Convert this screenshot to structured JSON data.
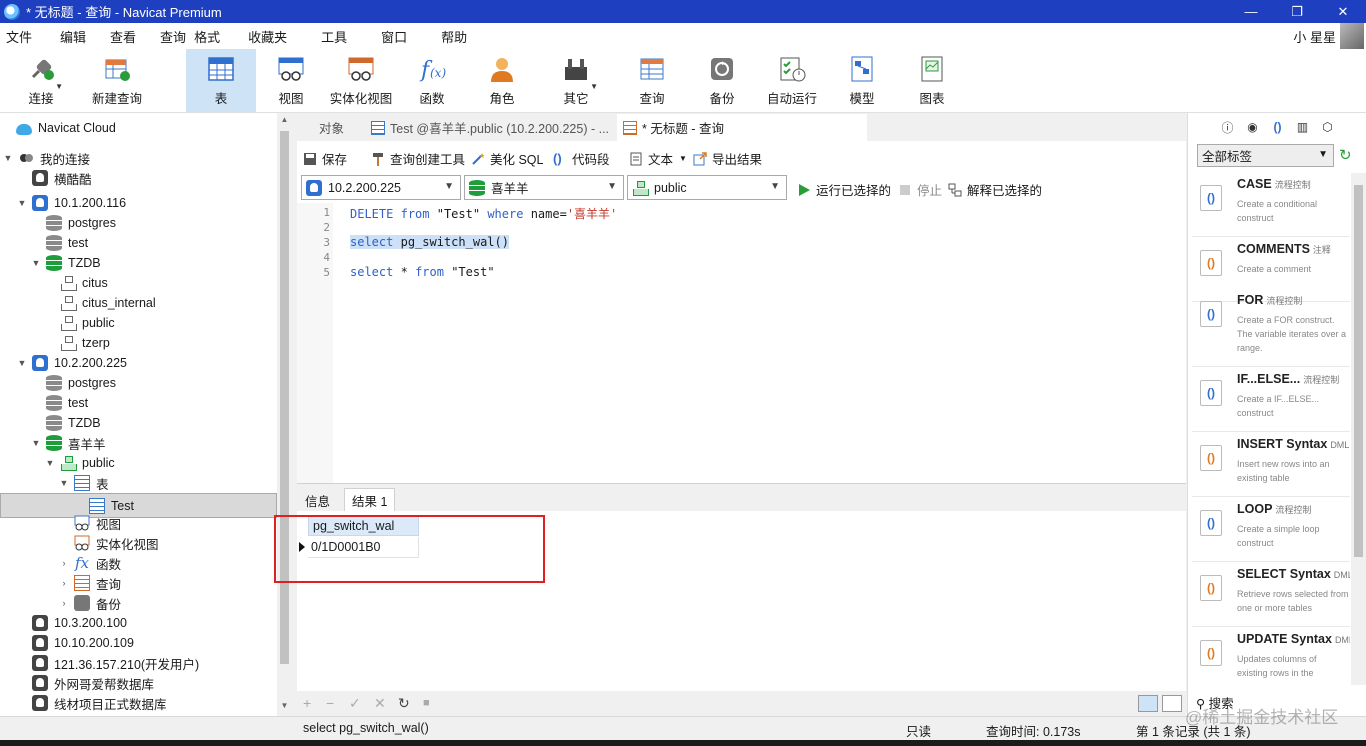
{
  "window": {
    "title": "* 无标题 - 查询 - Navicat Premium",
    "minimize": "—",
    "restore": "❐",
    "close": "✕"
  },
  "menu": {
    "items": [
      "文件",
      "编辑",
      "查看",
      "查询",
      "格式",
      "收藏夹",
      "工具",
      "窗口",
      "帮助"
    ],
    "user": "小 星星"
  },
  "toolbar": {
    "items": [
      {
        "label": "连接",
        "icon": "plug-icon"
      },
      {
        "label": "新建查询",
        "icon": "new-query-icon"
      },
      {
        "label": "表",
        "icon": "table-icon"
      },
      {
        "label": "视图",
        "icon": "view-icon"
      },
      {
        "label": "实体化视图",
        "icon": "materialized-view-icon"
      },
      {
        "label": "函数",
        "icon": "function-icon"
      },
      {
        "label": "角色",
        "icon": "role-icon"
      },
      {
        "label": "其它",
        "icon": "tools-icon"
      },
      {
        "label": "查询",
        "icon": "query-icon"
      },
      {
        "label": "备份",
        "icon": "backup-icon"
      },
      {
        "label": "自动运行",
        "icon": "automation-icon"
      },
      {
        "label": "模型",
        "icon": "model-icon"
      },
      {
        "label": "图表",
        "icon": "chart-icon"
      }
    ]
  },
  "tree": {
    "nodes": [
      {
        "label": "Navicat Cloud"
      },
      {
        "label": "我的连接"
      },
      {
        "label": "横酷酷"
      },
      {
        "label": "10.1.200.116"
      },
      {
        "label": "postgres"
      },
      {
        "label": "test"
      },
      {
        "label": "TZDB"
      },
      {
        "label": "citus"
      },
      {
        "label": "citus_internal"
      },
      {
        "label": "public"
      },
      {
        "label": "tzerp"
      },
      {
        "label": "10.2.200.225"
      },
      {
        "label": "postgres"
      },
      {
        "label": "test"
      },
      {
        "label": "TZDB"
      },
      {
        "label": "喜羊羊"
      },
      {
        "label": "public"
      },
      {
        "label": "表"
      },
      {
        "label": "Test"
      },
      {
        "label": "视图"
      },
      {
        "label": "实体化视图"
      },
      {
        "label": "函数"
      },
      {
        "label": "查询"
      },
      {
        "label": "备份"
      },
      {
        "label": "10.3.200.100"
      },
      {
        "label": "10.10.200.109"
      },
      {
        "label": "121.36.157.210(开发用户)"
      },
      {
        "label": "外网哥爱帮数据库"
      },
      {
        "label": "线材项目正式数据库"
      }
    ]
  },
  "tabs": {
    "objects": "对象",
    "table_tab": "Test @喜羊羊.public (10.2.200.225) - ...",
    "query_tab": "* 无标题 - 查询"
  },
  "query_toolbar": {
    "save": "保存",
    "builder": "查询创建工具",
    "beautify": "美化 SQL",
    "snippet": "代码段",
    "text": "文本",
    "export": "导出结果"
  },
  "selectors": {
    "connection": "10.2.200.225",
    "database": "喜羊羊",
    "schema": "public",
    "run_selected": "运行已选择的",
    "stop": "停止",
    "explain_selected": "解释已选择的"
  },
  "editor": {
    "line_numbers": [
      "1",
      "2",
      "3",
      "4",
      "5"
    ],
    "line1": {
      "kw1": "DELETE",
      "kw2": "from",
      "t1": "\"Test\"",
      "kw3": "where",
      "t2": "name=",
      "s": "'喜羊羊'"
    },
    "line3": {
      "kw": "select",
      "t": "pg_switch_wal()"
    },
    "line5": {
      "kw1": "select",
      "t1": "*",
      "kw2": "from",
      "t2": "\"Test\""
    }
  },
  "result_tabs": {
    "info": "信息",
    "result1": "结果 1"
  },
  "result": {
    "columns": [
      "pg_switch_wal"
    ],
    "rows": [
      [
        "0/1D0001B0"
      ]
    ]
  },
  "grid_toolbar": {
    "add": "+",
    "remove": "−",
    "apply": "✓",
    "discard": "✕",
    "refresh": "↻",
    "stop": "■"
  },
  "snippets_panel": {
    "filter": "全部标签",
    "items": [
      {
        "name": "CASE",
        "tag": "流程控制",
        "desc": "Create a conditional construct"
      },
      {
        "name": "COMMENTS",
        "tag": "注释",
        "desc": "Create a comment"
      },
      {
        "name": "FOR",
        "tag": "流程控制",
        "desc": "Create a FOR construct. The variable iterates over a range."
      },
      {
        "name": "IF...ELSE...",
        "tag": "流程控制",
        "desc": "Create a IF...ELSE... construct"
      },
      {
        "name": "INSERT Syntax",
        "tag": "DML",
        "desc": "Insert new rows into an existing table"
      },
      {
        "name": "LOOP",
        "tag": "流程控制",
        "desc": "Create a simple loop construct"
      },
      {
        "name": "SELECT Syntax",
        "tag": "DML",
        "desc": "Retrieve rows selected from one or more tables"
      },
      {
        "name": "UPDATE Syntax",
        "tag": "DML",
        "desc": "Updates columns of existing rows in the"
      }
    ],
    "search": "搜索"
  },
  "status": {
    "sql": "select pg_switch_wal()",
    "readonly": "只读",
    "time": "查询时间: 0.173s",
    "records": "第 1 条记录 (共 1 条)",
    "watermark": "@稀土掘金技术社区"
  }
}
